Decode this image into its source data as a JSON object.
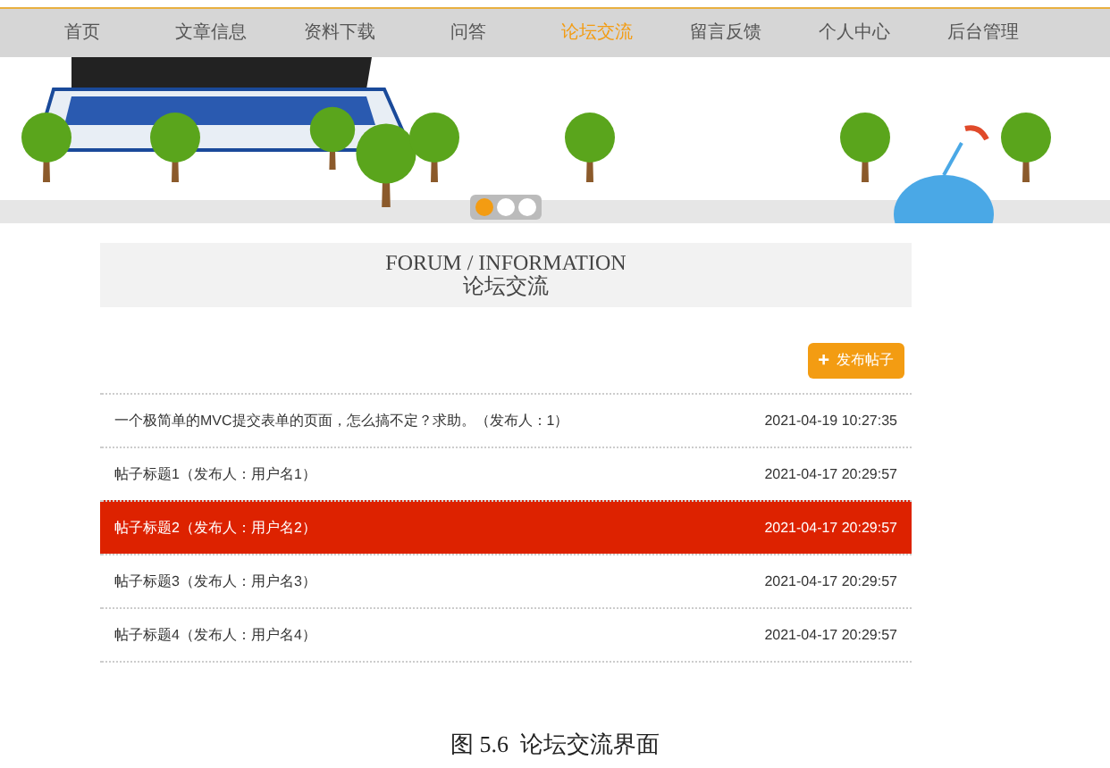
{
  "nav": [
    {
      "label": "首页",
      "selected": false
    },
    {
      "label": "文章信息",
      "selected": false
    },
    {
      "label": "资料下载",
      "selected": false
    },
    {
      "label": "问答",
      "selected": false
    },
    {
      "label": "论坛交流",
      "selected": true
    },
    {
      "label": "留言反馈",
      "selected": false
    },
    {
      "label": "个人中心",
      "selected": false
    },
    {
      "label": "后台管理",
      "selected": false
    }
  ],
  "banner": {
    "dots": [
      {
        "selected": true
      },
      {
        "selected": false
      },
      {
        "selected": false
      }
    ]
  },
  "section": {
    "title": "FORUM / INFORMATION",
    "subtitle": "论坛交流"
  },
  "post_button": {
    "icon": "+",
    "label": "发布帖子"
  },
  "posts": [
    {
      "title": "一个极简单的MVC提交表单的页面，怎么搞不定？求助。（发布人：1）",
      "time": "2021-04-19 10:27:35",
      "selected": false
    },
    {
      "title": "帖子标题1（发布人：用户名1）",
      "time": "2021-04-17 20:29:57",
      "selected": false
    },
    {
      "title": "帖子标题2（发布人：用户名2）",
      "time": "2021-04-17 20:29:57",
      "selected": true
    },
    {
      "title": "帖子标题3（发布人：用户名3）",
      "time": "2021-04-17 20:29:57",
      "selected": false
    },
    {
      "title": "帖子标题4（发布人：用户名4）",
      "time": "2021-04-17 20:29:57",
      "selected": false
    }
  ],
  "caption": "图 5.6  论坛交流界面"
}
